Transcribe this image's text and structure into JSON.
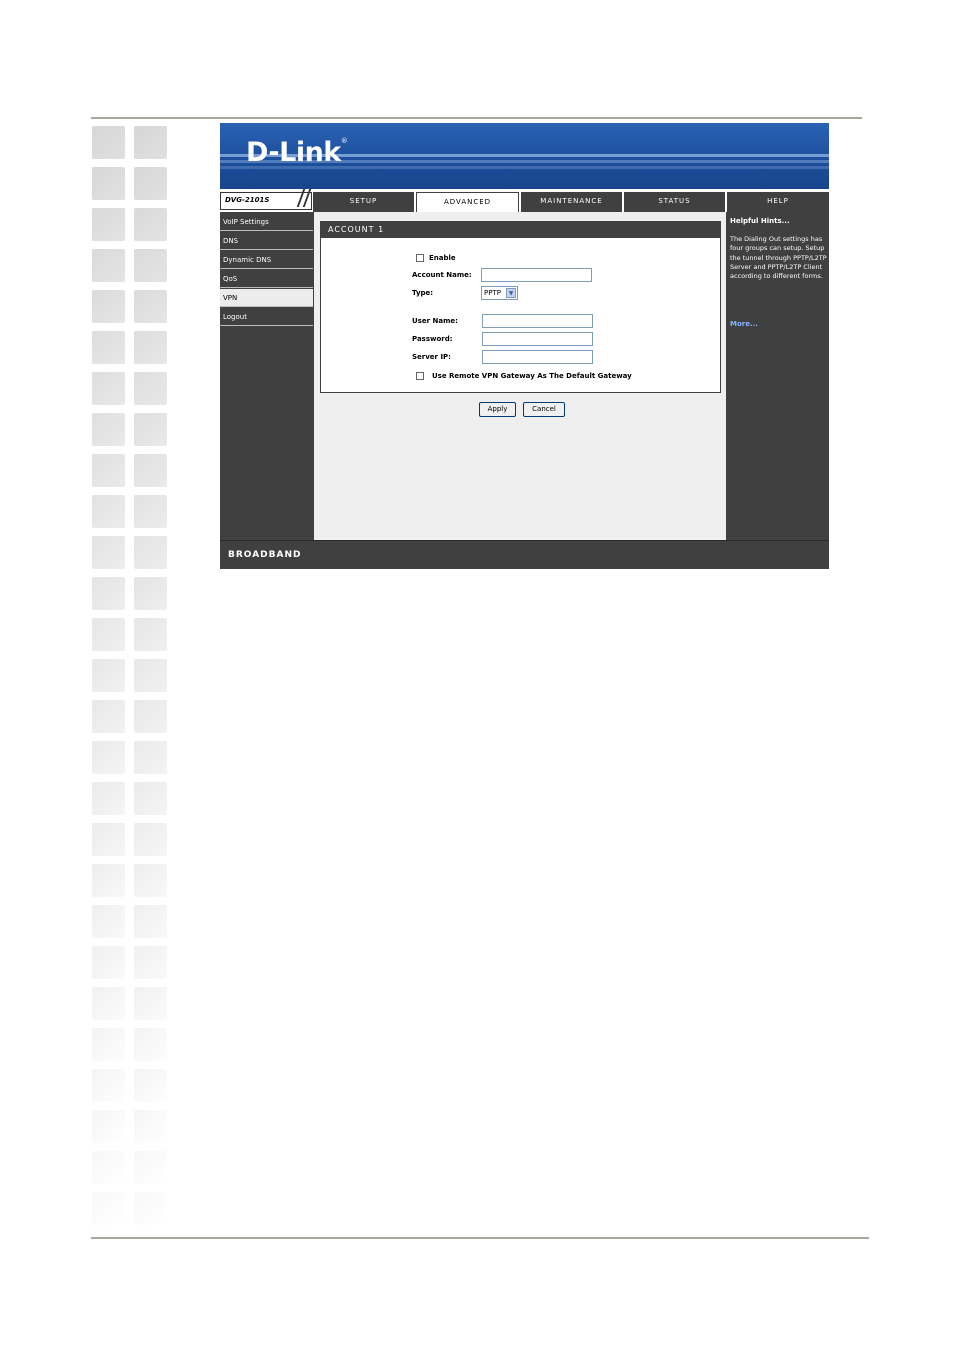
{
  "brand": {
    "logo": "D-Link",
    "registered": "®",
    "model": "DVG-2101S",
    "footer": "BROADBAND"
  },
  "tabs": [
    {
      "label": "SETUP"
    },
    {
      "label": "ADVANCED",
      "active": true
    },
    {
      "label": "MAINTENANCE"
    },
    {
      "label": "STATUS"
    },
    {
      "label": "HELP"
    }
  ],
  "sidebar": {
    "items": [
      {
        "label": "VoIP Settings"
      },
      {
        "label": "DNS"
      },
      {
        "label": "Dynamic DNS"
      },
      {
        "label": "QoS"
      },
      {
        "label": "VPN",
        "active": true
      },
      {
        "label": "Logout"
      }
    ]
  },
  "form": {
    "title": "ACCOUNT 1",
    "enable_label": "Enable",
    "enable_checked": false,
    "account_name_label": "Account Name:",
    "account_name_value": "",
    "type_label": "Type:",
    "type_value": "PPTP",
    "user_name_label": "User Name:",
    "user_name_value": "",
    "password_label": "Password:",
    "password_value": "",
    "server_ip_label": "Server IP:",
    "server_ip_value": "",
    "default_gateway_label": "Use Remote VPN Gateway As The Default Gateway",
    "default_gateway_checked": false,
    "apply_label": "Apply",
    "cancel_label": "Cancel"
  },
  "help": {
    "title": "Helpful Hints...",
    "text": "The Dialing Out settings has four groups can setup. Setup the tunnel through PPTP/L2TP Server and PPTP/L2TP Client according to different forms.",
    "more": "More..."
  },
  "colors": {
    "banner": "#1d4f9c",
    "dark": "#404040",
    "link": "#8ab4ff"
  }
}
